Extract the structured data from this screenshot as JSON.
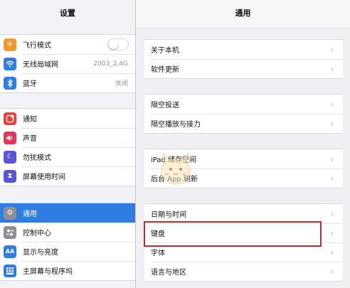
{
  "sidebar": {
    "title": "设置",
    "groups": [
      {
        "items": [
          {
            "label": "飞行模式",
            "icon": "airplane-icon",
            "color": "#f29a2e",
            "control": "toggle",
            "toggle_on": false
          },
          {
            "label": "无线局域网",
            "icon": "wifi-icon",
            "color": "#2f7de1",
            "value": "2003_2.4G"
          },
          {
            "label": "蓝牙",
            "icon": "bluetooth-icon",
            "color": "#2f7de1",
            "value": "关闭"
          }
        ]
      },
      {
        "items": [
          {
            "label": "通知",
            "icon": "notifications-icon",
            "color": "#e5443a"
          },
          {
            "label": "声音",
            "icon": "sound-icon",
            "color": "#e5345a"
          },
          {
            "label": "勿扰模式",
            "icon": "moon-icon",
            "color": "#5856d6"
          },
          {
            "label": "屏幕使用时间",
            "icon": "hourglass-icon",
            "color": "#5856d6"
          }
        ]
      },
      {
        "items": [
          {
            "label": "通用",
            "icon": "gear-icon",
            "color": "#8e8e93",
            "selected": true
          },
          {
            "label": "控制中心",
            "icon": "control-center-icon",
            "color": "#8e8e93"
          },
          {
            "label": "显示与亮度",
            "icon": "display-icon",
            "color": "#2f7de1"
          },
          {
            "label": "主屏幕与程序坞",
            "icon": "home-screen-icon",
            "color": "#2f7de1"
          }
        ]
      }
    ]
  },
  "main": {
    "title": "通用",
    "groups": [
      {
        "items": [
          {
            "label": "关于本机"
          },
          {
            "label": "软件更新"
          }
        ]
      },
      {
        "items": [
          {
            "label": "隔空投送"
          },
          {
            "label": "隔空播放与接力"
          }
        ]
      },
      {
        "items": [
          {
            "label": "iPad 储存空间"
          },
          {
            "label": "后台 App 刷新"
          }
        ]
      },
      {
        "items": [
          {
            "label": "日期与时间"
          },
          {
            "label": "键盘",
            "highlighted": true
          },
          {
            "label": "字体"
          },
          {
            "label": "语言与地区"
          }
        ]
      }
    ]
  },
  "colors": {
    "selected_row": "#2f7de1",
    "highlight_box": "#b8302e"
  }
}
